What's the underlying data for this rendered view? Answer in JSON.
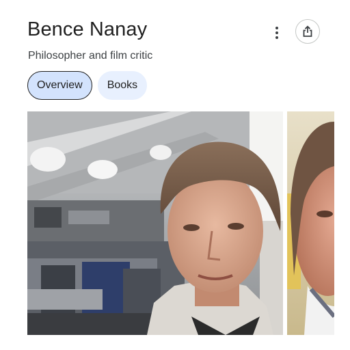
{
  "header": {
    "title": "Bence Nanay",
    "subtitle": "Philosopher and film critic"
  },
  "actions": {
    "more_icon": "more-vert-icon",
    "share_icon": "share-icon"
  },
  "tabs": [
    {
      "label": "Overview",
      "selected": true
    },
    {
      "label": "Books",
      "selected": false
    }
  ],
  "images": [
    {
      "name": "photo-1"
    },
    {
      "name": "photo-2"
    }
  ],
  "colors": {
    "chip_active_bg": "#d3e3fd",
    "chip_inactive_bg": "#e8f0fe",
    "title_text": "#1f1f1f"
  }
}
